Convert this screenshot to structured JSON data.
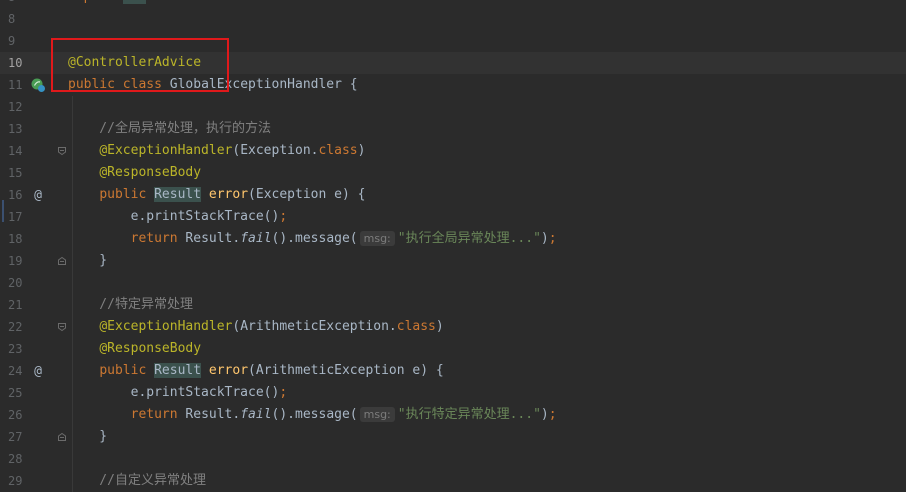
{
  "editor": {
    "lines": [
      {
        "num": "8",
        "tokens": [
          {
            "t": "import ",
            "c": "kw"
          },
          {
            "t": "...",
            "c": "hl"
          }
        ]
      },
      {
        "num": "8",
        "tokens": []
      },
      {
        "num": "9",
        "tokens": []
      },
      {
        "num": "10",
        "caret": true,
        "tokens": [
          {
            "t": "@ControllerAdvice",
            "c": "ann"
          }
        ]
      },
      {
        "num": "11",
        "marker": "bean-icon",
        "tokens": [
          {
            "t": "public ",
            "c": "kw"
          },
          {
            "t": "class ",
            "c": "kw"
          },
          {
            "t": "GlobalExceptionHandler {",
            "c": ""
          }
        ]
      },
      {
        "num": "12",
        "tokens": []
      },
      {
        "num": "13",
        "tokens": [
          {
            "t": "    //全局异常处理，执行的方法",
            "c": "cm"
          }
        ]
      },
      {
        "num": "14",
        "fold": "open",
        "tokens": [
          {
            "t": "    ",
            "c": ""
          },
          {
            "t": "@ExceptionHandler",
            "c": "ann"
          },
          {
            "t": "(Exception.",
            "c": ""
          },
          {
            "t": "class",
            "c": "kw"
          },
          {
            "t": ")",
            "c": ""
          }
        ]
      },
      {
        "num": "15",
        "tokens": [
          {
            "t": "    ",
            "c": ""
          },
          {
            "t": "@ResponseBody",
            "c": "ann"
          }
        ]
      },
      {
        "num": "16",
        "marker": "at",
        "tokens": [
          {
            "t": "    ",
            "c": ""
          },
          {
            "t": "public ",
            "c": "kw"
          },
          {
            "t": "Result",
            "c": "hl"
          },
          {
            "t": " ",
            "c": ""
          },
          {
            "t": "error",
            "c": "fn"
          },
          {
            "t": "(Exception e) {",
            "c": ""
          }
        ]
      },
      {
        "num": "17",
        "tokens": [
          {
            "t": "        e.printStackTrace()",
            "c": ""
          },
          {
            "t": ";",
            "c": "kw"
          }
        ]
      },
      {
        "num": "18",
        "tokens": [
          {
            "t": "        ",
            "c": ""
          },
          {
            "t": "return ",
            "c": "kw"
          },
          {
            "t": "Result.",
            "c": ""
          },
          {
            "t": "fail",
            "c": "it"
          },
          {
            "t": "().message(",
            "c": ""
          },
          {
            "t": "msg:",
            "c": "hint"
          },
          {
            "t": "\"执行全局异常处理...\"",
            "c": "str"
          },
          {
            "t": ")",
            "c": ""
          },
          {
            "t": ";",
            "c": "kw"
          }
        ]
      },
      {
        "num": "19",
        "fold": "close",
        "tokens": [
          {
            "t": "    }",
            "c": ""
          }
        ]
      },
      {
        "num": "20",
        "tokens": []
      },
      {
        "num": "21",
        "tokens": [
          {
            "t": "    //特定异常处理",
            "c": "cm"
          }
        ]
      },
      {
        "num": "22",
        "fold": "open",
        "tokens": [
          {
            "t": "    ",
            "c": ""
          },
          {
            "t": "@ExceptionHandler",
            "c": "ann"
          },
          {
            "t": "(ArithmeticException.",
            "c": ""
          },
          {
            "t": "class",
            "c": "kw"
          },
          {
            "t": ")",
            "c": ""
          }
        ]
      },
      {
        "num": "23",
        "tokens": [
          {
            "t": "    ",
            "c": ""
          },
          {
            "t": "@ResponseBody",
            "c": "ann"
          }
        ]
      },
      {
        "num": "24",
        "marker": "at",
        "tokens": [
          {
            "t": "    ",
            "c": ""
          },
          {
            "t": "public ",
            "c": "kw"
          },
          {
            "t": "Result",
            "c": "hl"
          },
          {
            "t": " ",
            "c": ""
          },
          {
            "t": "error",
            "c": "fn"
          },
          {
            "t": "(ArithmeticException e) {",
            "c": ""
          }
        ]
      },
      {
        "num": "25",
        "tokens": [
          {
            "t": "        e.printStackTrace()",
            "c": ""
          },
          {
            "t": ";",
            "c": "kw"
          }
        ]
      },
      {
        "num": "26",
        "tokens": [
          {
            "t": "        ",
            "c": ""
          },
          {
            "t": "return ",
            "c": "kw"
          },
          {
            "t": "Result.",
            "c": ""
          },
          {
            "t": "fail",
            "c": "it"
          },
          {
            "t": "().message(",
            "c": ""
          },
          {
            "t": "msg:",
            "c": "hint"
          },
          {
            "t": "\"执行特定异常处理...\"",
            "c": "str"
          },
          {
            "t": ")",
            "c": ""
          },
          {
            "t": ";",
            "c": "kw"
          }
        ]
      },
      {
        "num": "27",
        "fold": "close",
        "tokens": [
          {
            "t": "    }",
            "c": ""
          }
        ]
      },
      {
        "num": "28",
        "tokens": []
      },
      {
        "num": "29",
        "tokens": [
          {
            "t": "    //自定义异常处理",
            "c": "cm"
          }
        ]
      }
    ],
    "colors": {
      "background": "#2b2b2b",
      "keyword": "#cc7832",
      "annotation": "#bbb529",
      "comment": "#808080",
      "string": "#6a8759",
      "method": "#ffc66d",
      "highlight_box": "#e0191b"
    }
  }
}
